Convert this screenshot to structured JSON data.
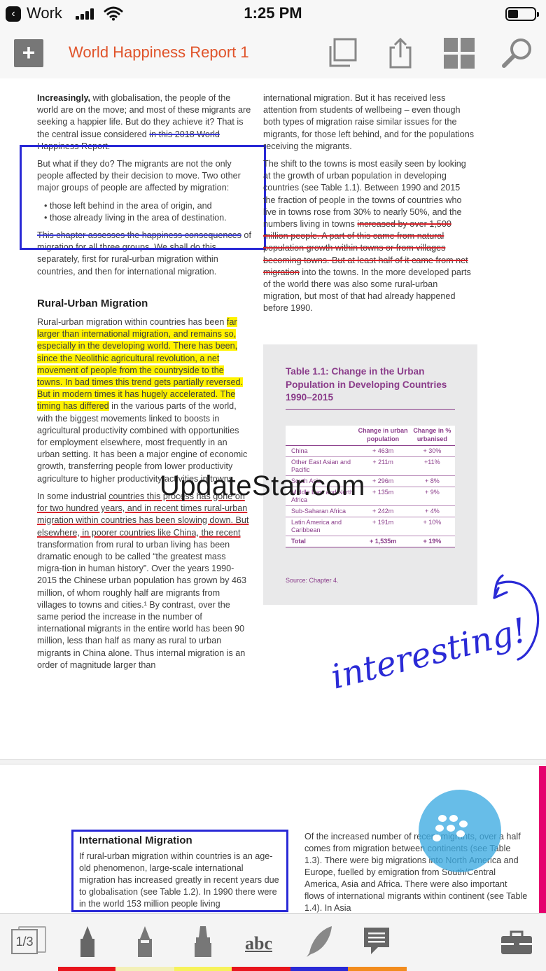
{
  "status_bar": {
    "carrier": "Work",
    "time": "1:25 PM"
  },
  "toolbar": {
    "document_title": "World Happiness Report 1"
  },
  "page1": {
    "left_col": {
      "p1_bold": "Increasingly,",
      "p1_rest": " with globalisation, the people of the world are on the move; and most of these migrants are seeking a happier life. But do they achieve it? That is the central issue considered ",
      "p1_strike": "in this 2018 World Happiness Report.",
      "p2": "But what if they do? The migrants are not the only people affected by their decision to move. Two other major groups of people are affected by migration:",
      "bullets": [
        "those left behind in the area of origin, and",
        "those already living in the area of destination."
      ],
      "p3_strike": "This chapter assesses the happiness consequences",
      "p3_rest": " of migration for all three groups. We shall do this separately, first for rural-urban migration within countries, and then for international migration.",
      "heading": "Rural-Urban Migration",
      "p4_start": "Rural-urban migration within countries has been ",
      "p4_highlight": "far larger than international migration, and remains so, especially in the developing world. There has been, since the Neolithic agricultural revolution, a net movement of people from the countryside to the towns. In bad times this trend gets partially reversed. But in modern times it has hugely accelerated. The timing has differed",
      "p4_rest": " in the various parts of the world, with the biggest movements linked to boosts in agricultural productivity combined with opportunities for employment elsewhere, most frequently in an urban setting. It has been a major engine of economic growth, transferring people from lower productivity agriculture to higher productivity activities in towns.",
      "p5_start": "In some industrial ",
      "p5_underline": "countries this process has gone on for two hundred years, and in recent times rural-urban migration within countries has been slowing down. But elsewhere, in poorer countries like China, the recent",
      "p5_rest": " transformation from rural to urban living has been dramatic enough to be called “the greatest mass migra-tion in human history”. Over the years 1990-2015 the Chinese urban population has grown by 463 million, of whom roughly half are migrants from villages to towns and cities.¹ By contrast, over the same period the increase in the number of international migrants in the entire world has been 90 million, less than half as many as rural to urban migrants in China alone. Thus internal migration is an order of magnitude larger than"
    },
    "right_col": {
      "p1": "international migration. But it has received less attention from students of wellbeing – even though both types of migration raise similar issues for the migrants, for those left behind, and for the populations receiving the migrants.",
      "p2_start": "The shift to the towns is most easily seen by looking at the growth of urban population in developing countries (see Table 1.1). Between 1990 and 2015 the fraction of people in the towns of countries who live in towns rose from 30% to nearly 50%, and the numbers living in towns ",
      "p2_strike": "increased by over 1,500 million people. A part of this came from natural population growth within towns or from villages becoming towns. But at least half of it came from net migration",
      "p2_rest": " into the towns. In the more developed parts of the world there was also some rural-urban migration, but most of that had already happened before 1990."
    },
    "table": {
      "title": "Table 1.1: Change in the Urban Population in Developing Countries 1990–2015",
      "col1": "Change in urban population",
      "col2": "Change in % urbanised",
      "rows": [
        {
          "region": "China",
          "pop": "+ 463m",
          "pct": "+ 30%"
        },
        {
          "region": "Other East Asian and Pacific",
          "pop": "+ 211m",
          "pct": "+11%"
        },
        {
          "region": "South Asia",
          "pop": "+ 296m",
          "pct": "+ 8%"
        },
        {
          "region": "Middle East and North Africa",
          "pop": "+ 135m",
          "pct": "+ 9%"
        },
        {
          "region": "Sub-Saharan Africa",
          "pop": "+ 242m",
          "pct": "+ 4%"
        },
        {
          "region": "Latin America and Caribbean",
          "pop": "+ 191m",
          "pct": "+ 10%"
        }
      ],
      "total": {
        "region": "Total",
        "pop": "+ 1,535m",
        "pct": "+ 19%"
      },
      "source": "Source: Chapter 4."
    },
    "watermark": "UpdateStar.com",
    "annotation": "interesting!"
  },
  "page2": {
    "box_title": "International Migration",
    "box_text": "If rural-urban migration within countries is an age-old phenomenon, large-scale international migration has increased greatly in recent years due to globalisation (see Table 1.2). In 1990 there were in the world 153 million people living",
    "right_text": "Of the increased number of recent migrants, over a half comes from migration between continents (see Table 1.3). There were big migrations into North America and Europe, fuelled by emigration from South/Central America, Asia and Africa. There were also important flows of international migrants within continent (see Table 1.4). In Asia"
  },
  "bottom_bar": {
    "page_indicator": "1/3",
    "text_tool": "abc",
    "colors": [
      "#e8141c",
      "#f3f0b8",
      "#f7f25a",
      "#f0ea12",
      "#e8141c",
      "#2a2ad6",
      "#f28c1e"
    ]
  }
}
